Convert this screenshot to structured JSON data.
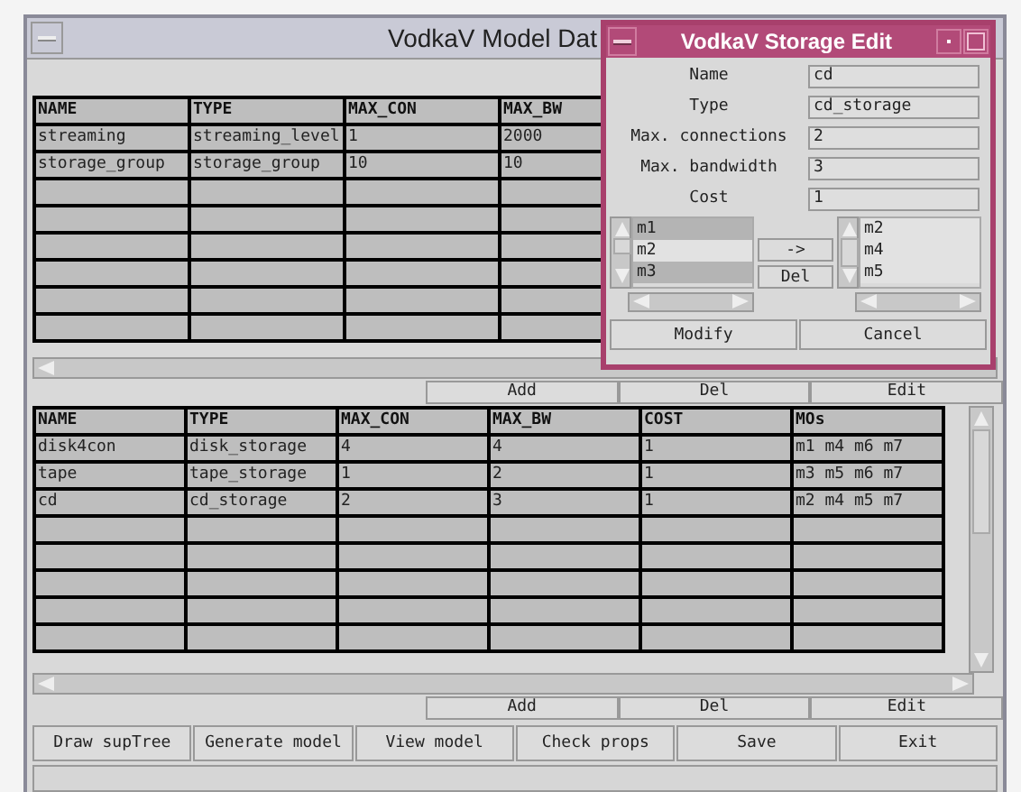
{
  "main_window": {
    "title": "VodkaV Model Dat",
    "top_table": {
      "columns": [
        "NAME",
        "TYPE",
        "MAX_CON",
        "MAX_BW"
      ],
      "rows": [
        [
          "streaming",
          "streaming_level",
          "1",
          "2000"
        ],
        [
          "storage_group",
          "storage_group",
          "10",
          "10"
        ]
      ]
    },
    "top_table_buttons": [
      "Add",
      "Del",
      "Edit"
    ],
    "bottom_table": {
      "columns": [
        "NAME",
        "TYPE",
        "MAX_CON",
        "MAX_BW",
        "COST",
        "MOs"
      ],
      "rows": [
        [
          "disk4con",
          "disk_storage",
          "4",
          "4",
          "1",
          "m1 m4 m6 m7"
        ],
        [
          "tape",
          "tape_storage",
          "1",
          "2",
          "1",
          "m3 m5 m6 m7"
        ],
        [
          "cd",
          "cd_storage",
          "2",
          "3",
          "1",
          "m2 m4 m5 m7"
        ]
      ]
    },
    "bottom_table_buttons": [
      "Add",
      "Del",
      "Edit"
    ],
    "action_buttons": [
      "Draw supTree",
      "Generate model",
      "View model",
      "Check props",
      "Save",
      "Exit"
    ]
  },
  "dialog": {
    "title": "VodkaV Storage Edit",
    "fields": [
      {
        "label": "Name",
        "value": "cd"
      },
      {
        "label": "Type",
        "value": "cd_storage"
      },
      {
        "label": "Max. connections",
        "value": "2"
      },
      {
        "label": "Max. bandwidth",
        "value": "3"
      },
      {
        "label": "Cost",
        "value": "1"
      }
    ],
    "available_list": [
      {
        "label": "m1",
        "selected": true
      },
      {
        "label": "m2",
        "selected": false
      },
      {
        "label": "m3",
        "selected": true
      }
    ],
    "move_buttons": [
      "->",
      "Del"
    ],
    "assigned_list": [
      "m2",
      "m4",
      "m5"
    ],
    "buttons": [
      "Modify",
      "Cancel"
    ]
  }
}
